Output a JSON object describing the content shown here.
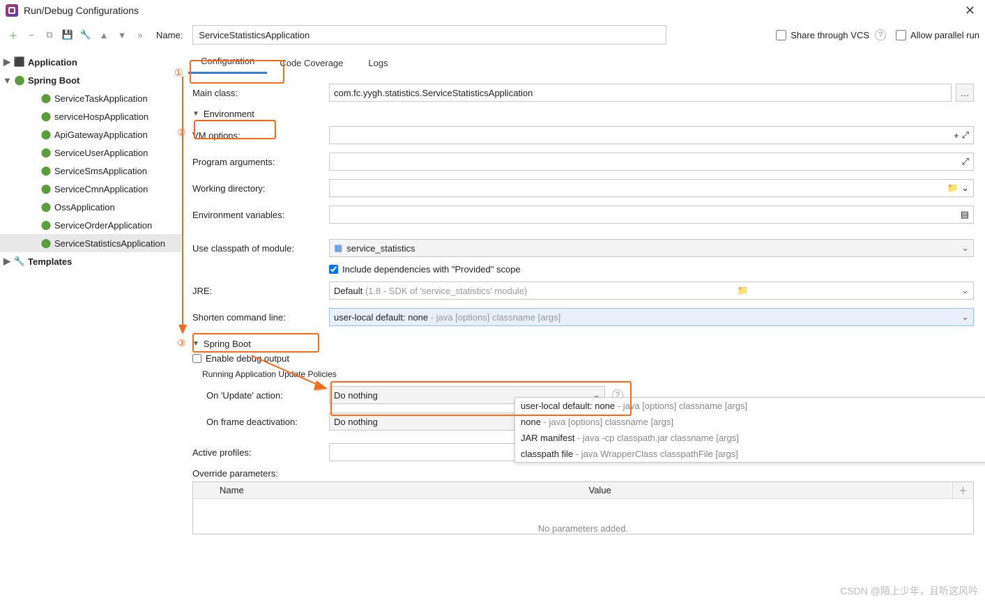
{
  "window": {
    "title": "Run/Debug Configurations"
  },
  "toolbar": {
    "name_label": "Name:",
    "name_value": "ServiceStatisticsApplication",
    "share_vcs": "Share through VCS",
    "allow_parallel": "Allow parallel run"
  },
  "tree": {
    "application": "Application",
    "spring_boot": "Spring Boot",
    "items": [
      "ServiceTaskApplication",
      "serviceHospApplication",
      "ApiGatewayApplication",
      "ServiceUserApplication",
      "ServiceSmsApplication",
      "ServiceCmnApplication",
      "OssApplication",
      "ServiceOrderApplication",
      "ServiceStatisticsApplication"
    ],
    "templates": "Templates"
  },
  "tabs": {
    "config": "Configuration",
    "coverage": "Code Coverage",
    "logs": "Logs"
  },
  "form": {
    "main_class_label": "Main class:",
    "main_class_value": "com.fc.yygh.statistics.ServiceStatisticsApplication",
    "env_header": "Environment",
    "vm_options_label": "VM options:",
    "program_args_label": "Program arguments:",
    "working_dir_label": "Working directory:",
    "env_vars_label": "Environment variables:",
    "classpath_label": "Use classpath of module:",
    "classpath_value": "service_statistics",
    "include_deps": "Include dependencies with \"Provided\" scope",
    "jre_label": "JRE:",
    "jre_value": "Default",
    "jre_hint": "(1.8 - SDK of 'service_statistics' module)",
    "shorten_label": "Shorten command line:",
    "shorten_value": "user-local default: none",
    "shorten_hint": "- java [options] classname [args]",
    "spring_boot_header": "Spring Boot",
    "enable_debug": "Enable debug output",
    "running_policies": "Running Application Update Policies",
    "on_update_label": "On 'Update' action:",
    "on_update_value": "Do nothing",
    "on_frame_label": "On frame deactivation:",
    "on_frame_value": "Do nothing",
    "active_profiles_label": "Active profiles:",
    "override_params_label": "Override parameters:",
    "th_name": "Name",
    "th_value": "Value",
    "no_params": "No parameters added."
  },
  "dropdown": {
    "items": [
      {
        "main": "user-local default: none",
        "hint": " - java [options] classname [args]"
      },
      {
        "main": "none",
        "hint": " - java [options] classname [args]"
      },
      {
        "main": "JAR manifest",
        "hint": " - java -cp classpath.jar classname [args]"
      },
      {
        "main": "classpath file",
        "hint": " - java WrapperClass classpathFile [args]"
      }
    ]
  },
  "annotations": {
    "n1": "①",
    "n2": "②",
    "n3": "③",
    "n4": "④"
  },
  "watermark": "CSDN @陌上少年，且听这风吟"
}
